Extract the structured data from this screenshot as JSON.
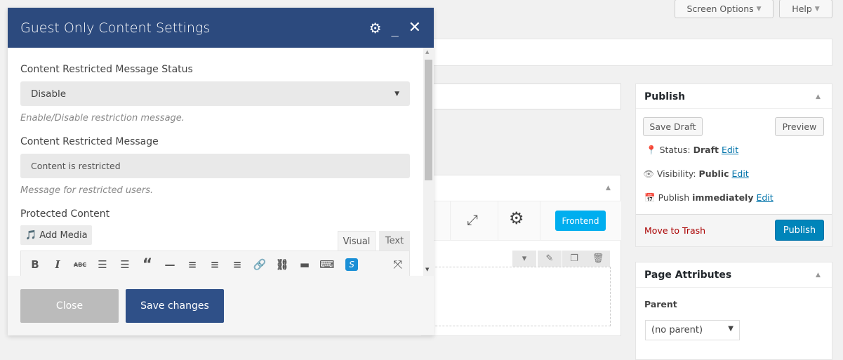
{
  "top": {
    "screen_options": "Screen Options",
    "help": "Help"
  },
  "publish": {
    "title": "Publish",
    "save_draft": "Save Draft",
    "preview": "Preview",
    "status_label": "Status:",
    "status_value": "Draft",
    "visibility_label": "Visibility:",
    "visibility_value": "Public",
    "publish_label": "Publish",
    "publish_value": "immediately",
    "edit": "Edit",
    "trash": "Move to Trash",
    "publish_button": "Publish"
  },
  "page_attributes": {
    "title": "Page Attributes",
    "parent_label": "Parent",
    "parent_value": "(no parent)"
  },
  "builder": {
    "frontend": "Frontend"
  },
  "modal": {
    "title": "Guest Only Content Settings",
    "status_label": "Content Restricted Message Status",
    "status_value": "Disable",
    "status_hint": "Enable/Disable restriction message.",
    "message_label": "Content Restricted Message",
    "message_value": "Content is restricted",
    "message_hint": "Message for restricted users.",
    "protected_label": "Protected Content",
    "add_media": "Add Media",
    "tab_visual": "Visual",
    "tab_text": "Text",
    "close": "Close",
    "save": "Save changes"
  },
  "colors": {
    "modal_header": "#2c4a7e",
    "save_button": "#2f5088",
    "frontend": "#00aeef",
    "publish": "#0085ba",
    "trash": "#a00"
  }
}
